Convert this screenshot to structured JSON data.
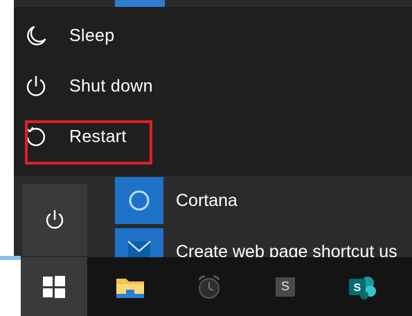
{
  "power_menu": {
    "items": [
      {
        "label": "Sleep",
        "icon": "moon-icon"
      },
      {
        "label": "Shut down",
        "icon": "power-icon"
      },
      {
        "label": "Restart",
        "icon": "restart-icon"
      }
    ],
    "highlighted": "Restart",
    "highlight_color": "#e01e24"
  },
  "app_list": {
    "items": [
      {
        "name": "Cortana",
        "icon": "cortana-icon"
      },
      {
        "name": "Create web page shortcut us",
        "icon": "mail-icon"
      }
    ]
  },
  "taskbar": {
    "items": [
      {
        "name": "start",
        "icon": "windows-icon"
      },
      {
        "name": "file-explorer",
        "icon": "folder-icon"
      },
      {
        "name": "alarms",
        "icon": "alarm-clock-icon"
      },
      {
        "name": "s-app",
        "icon": "s-icon",
        "label": "S"
      },
      {
        "name": "sharepoint",
        "icon": "sharepoint-icon",
        "label": "S"
      }
    ]
  },
  "colors": {
    "menu_bg": "#2b2b2b",
    "flyout_bg": "#1f1f1f",
    "tile_blue": "#1e72c8",
    "taskbar_bg": "#141414",
    "accent": "#8cbfe6"
  }
}
